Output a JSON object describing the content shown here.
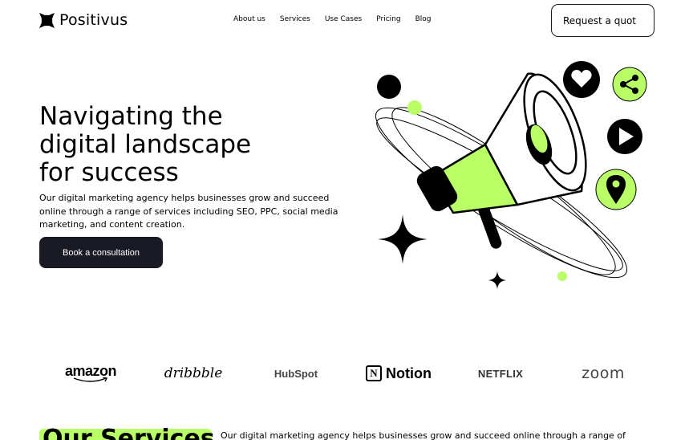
{
  "header": {
    "logo_text": "Positivus",
    "nav": [
      "About us",
      "Services",
      "Use Cases",
      "Pricing",
      "Blog"
    ],
    "quote_button": "Request a quot"
  },
  "hero": {
    "title_lines": [
      "Navigating the",
      "digital landscape",
      "for success"
    ],
    "description": "Our digital marketing agency helps businesses grow and succeed online through a range of services including SEO, PPC, social media marketing, and content creation.",
    "cta": "Book a consultation"
  },
  "brands": {
    "amazon": "amazon",
    "dribbble": "dribbble",
    "hubspot": "HubSpot",
    "notion": "Notion",
    "netflix": "NETFLIX",
    "zoom": "zoom"
  },
  "services": {
    "title": "Our Services",
    "description": "Our digital marketing agency helps businesses grow and succeed online through a range of"
  },
  "colors": {
    "accent": "#b9ff66",
    "dark": "#191a23"
  },
  "icons": [
    "logo-icon",
    "heart-icon",
    "share-icon",
    "play-icon",
    "location-pin-icon",
    "megaphone-illustration",
    "sparkle-star-icon"
  ]
}
